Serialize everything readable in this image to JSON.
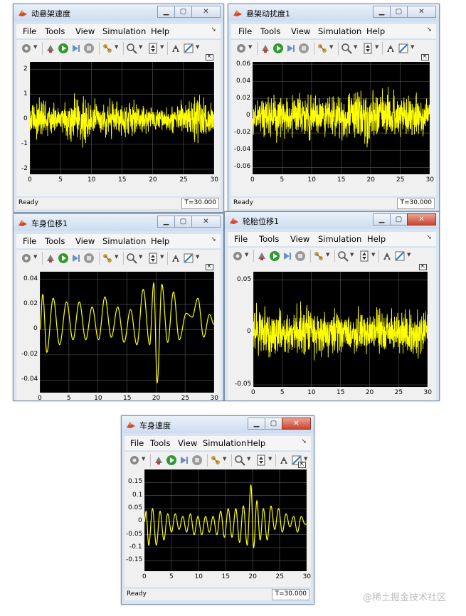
{
  "menus": [
    "File",
    "Tools",
    "View",
    "Simulation",
    "Help"
  ],
  "icons": {
    "app": "matlab-icon",
    "toolbar": [
      "settings-icon",
      "restore-config-icon",
      "run-icon",
      "step-forward-icon",
      "stop-icon",
      "signal-selector-icon",
      "zoom-icon",
      "autoscale-icon",
      "highlight-icon",
      "style-icon"
    ]
  },
  "colors": {
    "signal": "#ffff00",
    "plot_bg": "#000000",
    "grid": "#5a5a5a",
    "title_bar": "#d7e4f2",
    "close_active": "#c9452f"
  },
  "windows": [
    {
      "title": "动悬架速度",
      "status": "Ready",
      "sim_time": "T=30.000",
      "chart_data": {
        "type": "line",
        "title": "",
        "xlim": [
          0,
          30
        ],
        "ylim": [
          -2.2,
          2.3
        ],
        "xticks": [
          "0",
          "5",
          "10",
          "15",
          "20",
          "25",
          "30"
        ],
        "yticks": [
          "2",
          "1",
          "0",
          "-1",
          "-2"
        ],
        "ytick_values": [
          2,
          1,
          0,
          -1,
          -2
        ],
        "grid": true,
        "signal": "dense noise",
        "envelope": [
          [
            0,
            0.9
          ],
          [
            2,
            1.1
          ],
          [
            5,
            0.7
          ],
          [
            7,
            1.3
          ],
          [
            9,
            1.5
          ],
          [
            11,
            0.9
          ],
          [
            13,
            1.1
          ],
          [
            15,
            0.8
          ],
          [
            17,
            1.0
          ],
          [
            19,
            0.7
          ],
          [
            21,
            0.6
          ],
          [
            23,
            0.8
          ],
          [
            25,
            0.9
          ],
          [
            27,
            1.4
          ],
          [
            29,
            1.1
          ],
          [
            30,
            0.9
          ]
        ]
      }
    },
    {
      "title": "悬架动扰度1",
      "status": "Ready",
      "sim_time": "T=30.000",
      "chart_data": {
        "type": "line",
        "title": "",
        "xlim": [
          0,
          30
        ],
        "ylim": [
          -0.068,
          0.063
        ],
        "xticks": [
          "0",
          "5",
          "10",
          "15",
          "20",
          "25",
          "30"
        ],
        "yticks": [
          "0.06",
          "0.04",
          "0.02",
          "0",
          "-0.02",
          "-0.04",
          "-0.06"
        ],
        "ytick_values": [
          0.06,
          0.04,
          0.02,
          0,
          -0.02,
          -0.04,
          -0.06
        ],
        "grid": true,
        "signal": "dense noise",
        "envelope": [
          [
            0,
            0.025
          ],
          [
            3,
            0.035
          ],
          [
            6,
            0.03
          ],
          [
            9,
            0.04
          ],
          [
            12,
            0.03
          ],
          [
            15,
            0.035
          ],
          [
            18,
            0.04
          ],
          [
            20,
            0.05
          ],
          [
            22,
            0.04
          ],
          [
            25,
            0.03
          ],
          [
            28,
            0.035
          ],
          [
            30,
            0.03
          ]
        ]
      }
    },
    {
      "title": "车身位移1",
      "status": "",
      "sim_time": "",
      "chart_data": {
        "type": "line",
        "title": "",
        "xlim": [
          0,
          30
        ],
        "ylim": [
          -0.05,
          0.046
        ],
        "xticks": [
          "0",
          "5",
          "10",
          "15",
          "20",
          "25",
          "30"
        ],
        "yticks": [
          "0.04",
          "0.02",
          "0",
          "-0.02",
          "-0.04"
        ],
        "ytick_values": [
          0.04,
          0.02,
          0,
          -0.02,
          -0.04
        ],
        "grid": true,
        "signal": "oscillation",
        "peaks": [
          [
            0.5,
            0.028
          ],
          [
            1.2,
            -0.018
          ],
          [
            2.3,
            0.025
          ],
          [
            3.4,
            -0.012
          ],
          [
            4.6,
            0.022
          ],
          [
            5.7,
            -0.008
          ],
          [
            6.8,
            0.022
          ],
          [
            7.9,
            -0.008
          ],
          [
            9.0,
            0.018
          ],
          [
            10.1,
            -0.008
          ],
          [
            11.2,
            0.026
          ],
          [
            12.3,
            -0.006
          ],
          [
            13.4,
            0.018
          ],
          [
            14.5,
            -0.01
          ],
          [
            15.6,
            0.016
          ],
          [
            16.7,
            -0.012
          ],
          [
            17.8,
            0.032
          ],
          [
            18.9,
            -0.012
          ],
          [
            19.6,
            0.037
          ],
          [
            20.2,
            -0.042
          ],
          [
            21.0,
            0.036
          ],
          [
            22.0,
            -0.01
          ],
          [
            23.0,
            0.03
          ],
          [
            24.0,
            -0.008
          ],
          [
            25.2,
            0.013
          ],
          [
            26.2,
            0.01
          ],
          [
            27.2,
            0.025
          ],
          [
            28.2,
            -0.006
          ],
          [
            29.2,
            0.012
          ],
          [
            30,
            0.004
          ]
        ]
      }
    },
    {
      "title": "轮胎位移1",
      "status": "",
      "sim_time": "",
      "chart_data": {
        "type": "line",
        "title": "",
        "xlim": [
          0,
          30
        ],
        "ylim": [
          -0.052,
          0.058
        ],
        "xticks": [
          "0",
          "5",
          "10",
          "15",
          "20",
          "25",
          "30"
        ],
        "yticks": [
          "0.05",
          "0",
          "-0.05"
        ],
        "ytick_values": [
          0.05,
          0,
          -0.05
        ],
        "grid": true,
        "signal": "dense noise",
        "envelope": [
          [
            0,
            0.035
          ],
          [
            3,
            0.03
          ],
          [
            6,
            0.028
          ],
          [
            9,
            0.035
          ],
          [
            12,
            0.03
          ],
          [
            15,
            0.028
          ],
          [
            18,
            0.03
          ],
          [
            21,
            0.028
          ],
          [
            24,
            0.03
          ],
          [
            27,
            0.032
          ],
          [
            30,
            0.03
          ]
        ]
      }
    },
    {
      "title": "车身速度",
      "status": "Ready",
      "sim_time": "T=30.000",
      "chart_data": {
        "type": "line",
        "title": "",
        "xlim": [
          0,
          30
        ],
        "ylim": [
          -0.19,
          0.2
        ],
        "xticks": [
          "0",
          "5",
          "10",
          "15",
          "20",
          "25",
          "30"
        ],
        "yticks": [
          "0.15",
          "0.1",
          "0.05",
          "0",
          "-0.05",
          "-0.1",
          "-0.15"
        ],
        "ytick_values": [
          0.15,
          0.1,
          0.05,
          0,
          -0.05,
          -0.1,
          -0.15
        ],
        "grid": true,
        "signal": "oscillation",
        "peaks": [
          [
            0.3,
            0.04
          ],
          [
            0.8,
            -0.09
          ],
          [
            1.5,
            0.05
          ],
          [
            2.2,
            -0.09
          ],
          [
            2.9,
            0.04
          ],
          [
            3.6,
            -0.07
          ],
          [
            4.3,
            0.03
          ],
          [
            5.0,
            -0.04
          ],
          [
            5.7,
            0.03
          ],
          [
            6.4,
            -0.03
          ],
          [
            7.1,
            0.02
          ],
          [
            7.8,
            -0.04
          ],
          [
            8.5,
            0.03
          ],
          [
            9.2,
            -0.05
          ],
          [
            9.9,
            0.02
          ],
          [
            10.6,
            -0.05
          ],
          [
            11.3,
            0.02
          ],
          [
            12.0,
            -0.04
          ],
          [
            12.7,
            0.02
          ],
          [
            13.4,
            -0.05
          ],
          [
            14.1,
            0.04
          ],
          [
            14.8,
            -0.06
          ],
          [
            15.5,
            0.05
          ],
          [
            16.2,
            -0.06
          ],
          [
            16.9,
            0.05
          ],
          [
            17.6,
            -0.08
          ],
          [
            18.3,
            0.06
          ],
          [
            19.0,
            -0.09
          ],
          [
            19.7,
            0.14
          ],
          [
            20.2,
            -0.1
          ],
          [
            20.8,
            0.08
          ],
          [
            21.4,
            -0.07
          ],
          [
            22.0,
            0.05
          ],
          [
            22.7,
            -0.07
          ],
          [
            23.4,
            0.06
          ],
          [
            24.1,
            -0.03
          ],
          [
            24.8,
            0.05
          ],
          [
            25.5,
            -0.04
          ],
          [
            26.2,
            0.03
          ],
          [
            26.9,
            -0.02
          ],
          [
            27.6,
            0.02
          ],
          [
            28.3,
            -0.04
          ],
          [
            29.0,
            0.02
          ],
          [
            29.7,
            -0.01
          ]
        ]
      }
    }
  ],
  "watermark": "@稀土掘金技术社区"
}
